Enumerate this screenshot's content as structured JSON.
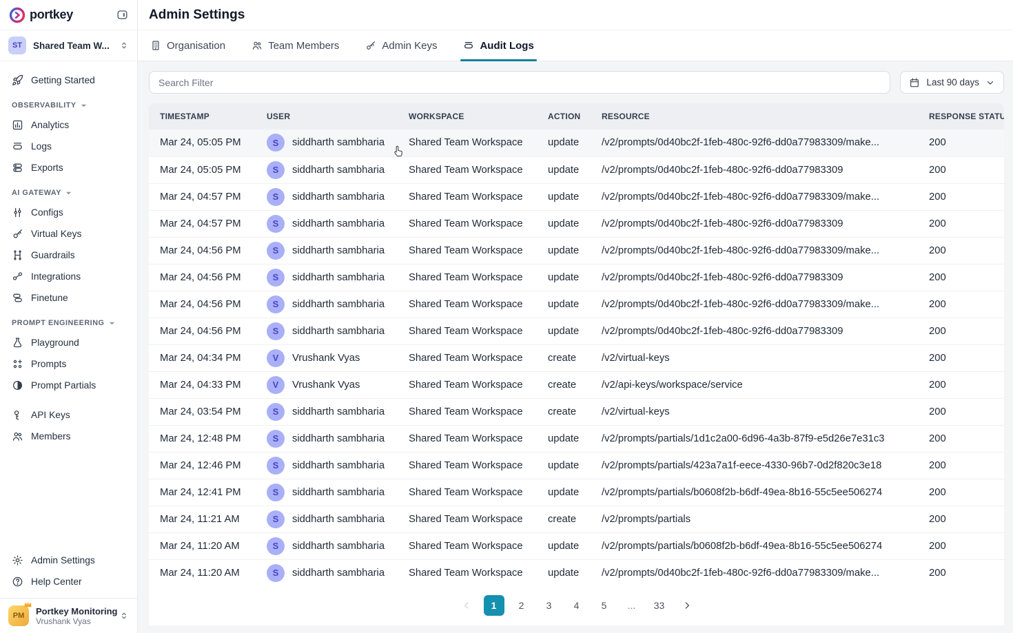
{
  "colors": {
    "accent_teal": "#1590af",
    "tab_underline": "#11809e",
    "user_avatar_bg": "#a9b0f8",
    "user_avatar_text": "#4c44c8",
    "workspace_avatar_bg": "#c9cffb",
    "org_avatar_gradient": [
      "#fbd76a",
      "#efa93a"
    ],
    "table_header_bg": "#edeff2"
  },
  "sidebar": {
    "logo_text": "portkey",
    "workspace": {
      "initials": "ST",
      "name": "Shared Team W..."
    },
    "sections": {
      "observability": "OBSERVABILITY",
      "ai_gateway": "AI GATEWAY",
      "prompt_engineering": "PROMPT ENGINEERING"
    },
    "nav": {
      "getting_started": "Getting Started",
      "analytics": "Analytics",
      "logs": "Logs",
      "exports": "Exports",
      "configs": "Configs",
      "virtual_keys": "Virtual Keys",
      "guardrails": "Guardrails",
      "integrations": "Integrations",
      "finetune": "Finetune",
      "playground": "Playground",
      "prompts": "Prompts",
      "prompt_partials": "Prompt Partials",
      "api_keys": "API Keys",
      "members": "Members",
      "admin_settings": "Admin Settings",
      "help_center": "Help Center"
    },
    "org": {
      "initials": "PM",
      "name": "Portkey Monitoring",
      "user": "Vrushank Vyas"
    }
  },
  "header": {
    "title": "Admin Settings",
    "tabs": [
      {
        "label": "Organisation"
      },
      {
        "label": "Team Members"
      },
      {
        "label": "Admin Keys"
      },
      {
        "label": "Audit Logs"
      }
    ],
    "active_tab": "Audit Logs"
  },
  "filters": {
    "search_placeholder": "Search Filter",
    "date_range": "Last 90 days"
  },
  "table": {
    "columns": [
      "TIMESTAMP",
      "USER",
      "WORKSPACE",
      "ACTION",
      "RESOURCE",
      "RESPONSE STATUS"
    ],
    "rows": [
      {
        "timestamp": "Mar 24, 05:05 PM",
        "user_initial": "S",
        "user": "siddharth sambharia",
        "workspace": "Shared Team Workspace",
        "action": "update",
        "resource": "/v2/prompts/0d40bc2f-1feb-480c-92f6-dd0a77983309/make...",
        "status": "200"
      },
      {
        "timestamp": "Mar 24, 05:05 PM",
        "user_initial": "S",
        "user": "siddharth sambharia",
        "workspace": "Shared Team Workspace",
        "action": "update",
        "resource": "/v2/prompts/0d40bc2f-1feb-480c-92f6-dd0a77983309",
        "status": "200"
      },
      {
        "timestamp": "Mar 24, 04:57 PM",
        "user_initial": "S",
        "user": "siddharth sambharia",
        "workspace": "Shared Team Workspace",
        "action": "update",
        "resource": "/v2/prompts/0d40bc2f-1feb-480c-92f6-dd0a77983309/make...",
        "status": "200"
      },
      {
        "timestamp": "Mar 24, 04:57 PM",
        "user_initial": "S",
        "user": "siddharth sambharia",
        "workspace": "Shared Team Workspace",
        "action": "update",
        "resource": "/v2/prompts/0d40bc2f-1feb-480c-92f6-dd0a77983309",
        "status": "200"
      },
      {
        "timestamp": "Mar 24, 04:56 PM",
        "user_initial": "S",
        "user": "siddharth sambharia",
        "workspace": "Shared Team Workspace",
        "action": "update",
        "resource": "/v2/prompts/0d40bc2f-1feb-480c-92f6-dd0a77983309/make...",
        "status": "200"
      },
      {
        "timestamp": "Mar 24, 04:56 PM",
        "user_initial": "S",
        "user": "siddharth sambharia",
        "workspace": "Shared Team Workspace",
        "action": "update",
        "resource": "/v2/prompts/0d40bc2f-1feb-480c-92f6-dd0a77983309",
        "status": "200"
      },
      {
        "timestamp": "Mar 24, 04:56 PM",
        "user_initial": "S",
        "user": "siddharth sambharia",
        "workspace": "Shared Team Workspace",
        "action": "update",
        "resource": "/v2/prompts/0d40bc2f-1feb-480c-92f6-dd0a77983309/make...",
        "status": "200"
      },
      {
        "timestamp": "Mar 24, 04:56 PM",
        "user_initial": "S",
        "user": "siddharth sambharia",
        "workspace": "Shared Team Workspace",
        "action": "update",
        "resource": "/v2/prompts/0d40bc2f-1feb-480c-92f6-dd0a77983309",
        "status": "200"
      },
      {
        "timestamp": "Mar 24, 04:34 PM",
        "user_initial": "V",
        "user": "Vrushank Vyas",
        "workspace": "Shared Team Workspace",
        "action": "create",
        "resource": "/v2/virtual-keys",
        "status": "200"
      },
      {
        "timestamp": "Mar 24, 04:33 PM",
        "user_initial": "V",
        "user": "Vrushank Vyas",
        "workspace": "Shared Team Workspace",
        "action": "create",
        "resource": "/v2/api-keys/workspace/service",
        "status": "200"
      },
      {
        "timestamp": "Mar 24, 03:54 PM",
        "user_initial": "S",
        "user": "siddharth sambharia",
        "workspace": "Shared Team Workspace",
        "action": "create",
        "resource": "/v2/virtual-keys",
        "status": "200"
      },
      {
        "timestamp": "Mar 24, 12:48 PM",
        "user_initial": "S",
        "user": "siddharth sambharia",
        "workspace": "Shared Team Workspace",
        "action": "update",
        "resource": "/v2/prompts/partials/1d1c2a00-6d96-4a3b-87f9-e5d26e7e31c3",
        "status": "200"
      },
      {
        "timestamp": "Mar 24, 12:46 PM",
        "user_initial": "S",
        "user": "siddharth sambharia",
        "workspace": "Shared Team Workspace",
        "action": "update",
        "resource": "/v2/prompts/partials/423a7a1f-eece-4330-96b7-0d2f820c3e18",
        "status": "200"
      },
      {
        "timestamp": "Mar 24, 12:41 PM",
        "user_initial": "S",
        "user": "siddharth sambharia",
        "workspace": "Shared Team Workspace",
        "action": "update",
        "resource": "/v2/prompts/partials/b0608f2b-b6df-49ea-8b16-55c5ee506274",
        "status": "200"
      },
      {
        "timestamp": "Mar 24, 11:21 AM",
        "user_initial": "S",
        "user": "siddharth sambharia",
        "workspace": "Shared Team Workspace",
        "action": "create",
        "resource": "/v2/prompts/partials",
        "status": "200"
      },
      {
        "timestamp": "Mar 24, 11:20 AM",
        "user_initial": "S",
        "user": "siddharth sambharia",
        "workspace": "Shared Team Workspace",
        "action": "update",
        "resource": "/v2/prompts/partials/b0608f2b-b6df-49ea-8b16-55c5ee506274",
        "status": "200"
      },
      {
        "timestamp": "Mar 24, 11:20 AM",
        "user_initial": "S",
        "user": "siddharth sambharia",
        "workspace": "Shared Team Workspace",
        "action": "update",
        "resource": "/v2/prompts/0d40bc2f-1feb-480c-92f6-dd0a77983309/make...",
        "status": "200"
      }
    ]
  },
  "pagination": {
    "pages": [
      "1",
      "2",
      "3",
      "4",
      "5",
      "...",
      "33"
    ],
    "active_page": "1"
  }
}
